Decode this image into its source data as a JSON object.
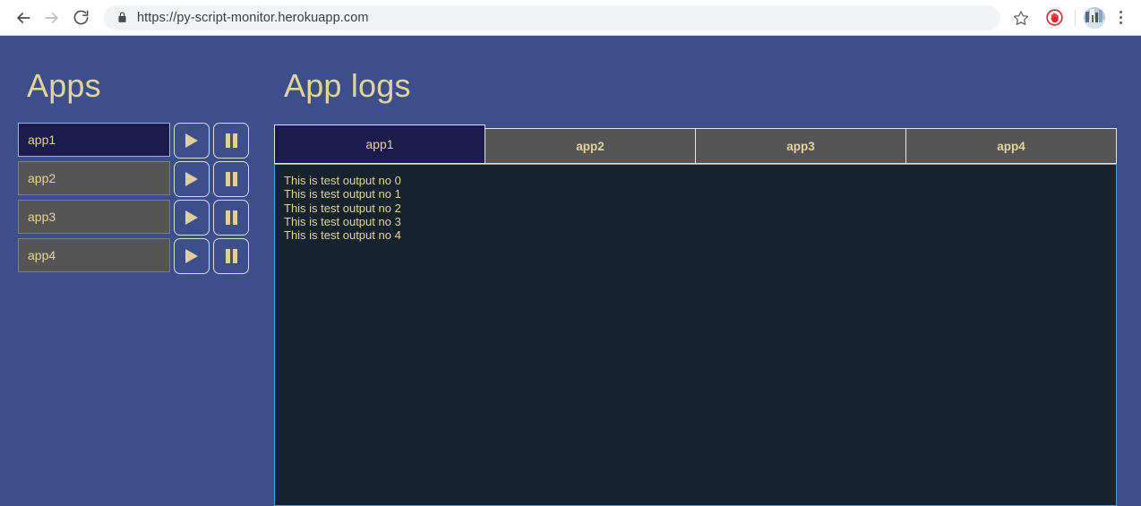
{
  "browser": {
    "back_label": "Back",
    "forward_label": "Forward",
    "reload_label": "Reload",
    "url": "https://py-script-monitor.herokuapp.com",
    "lock_icon": "lock-icon",
    "bookmark_icon": "star-icon",
    "extension_icon": "adblock-stop-hand-icon",
    "avatar_icon": "profile-avatar",
    "menu_icon": "three-dot-menu-icon"
  },
  "sidebar": {
    "title": "Apps",
    "apps": [
      {
        "name": "app1",
        "selected": true,
        "play_label": "Start app1",
        "pause_label": "Pause app1"
      },
      {
        "name": "app2",
        "selected": false,
        "play_label": "Start app2",
        "pause_label": "Pause app2"
      },
      {
        "name": "app3",
        "selected": false,
        "play_label": "Start app3",
        "pause_label": "Pause app3"
      },
      {
        "name": "app4",
        "selected": false,
        "play_label": "Start app4",
        "pause_label": "Pause app4"
      }
    ]
  },
  "main": {
    "title": "App logs",
    "tabs": [
      {
        "label": "app1",
        "active": true
      },
      {
        "label": "app2",
        "active": false
      },
      {
        "label": "app3",
        "active": false
      },
      {
        "label": "app4",
        "active": false
      }
    ],
    "log_lines": [
      "This is test output no 0",
      "This is test output no 1",
      "This is test output no 2",
      "This is test output no 3",
      "This is test output no 4"
    ]
  },
  "colors": {
    "page_background": "#3d4f8b",
    "accent_text": "#e4d39a",
    "selected_item": "#1b1b4d",
    "inactive_item": "#555555",
    "log_background": "#16222c",
    "log_border": "#5b9bd5"
  }
}
